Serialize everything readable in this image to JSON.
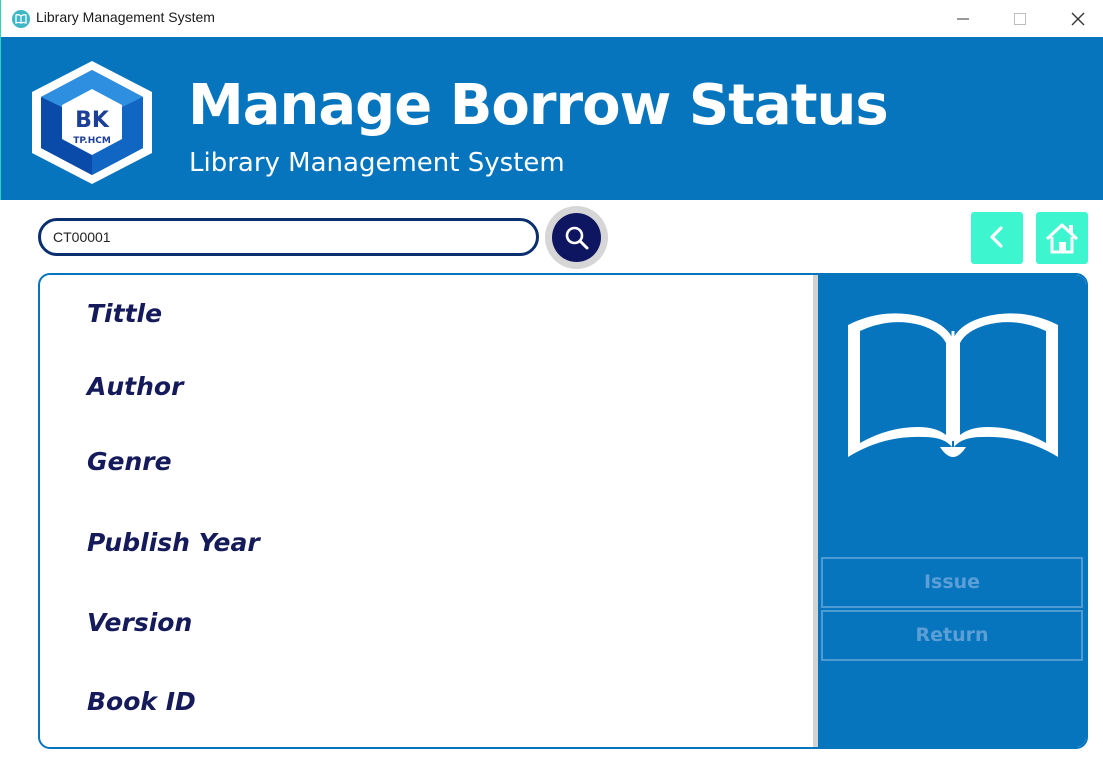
{
  "window": {
    "title": "Library Management System",
    "controls": [
      "minimize",
      "maximize",
      "close"
    ]
  },
  "header": {
    "logo": {
      "text": "BK",
      "subtext": "TP.HCM"
    },
    "title": "Manage Borrow Status",
    "subtitle": "Library Management System"
  },
  "search": {
    "value": "CT00001",
    "icon": "search-icon"
  },
  "nav": {
    "back_icon": "chevron-left-icon",
    "home_icon": "home-icon"
  },
  "fields": [
    {
      "label": "Tittle"
    },
    {
      "label": "Author"
    },
    {
      "label": "Genre"
    },
    {
      "label": "Publish Year"
    },
    {
      "label": "Version"
    },
    {
      "label": "Book ID"
    }
  ],
  "actions": {
    "issue_label": "Issue",
    "return_label": "Return"
  },
  "colors": {
    "primary": "#0675bd",
    "accent": "#3df5cf",
    "dark_navy": "#0f1661",
    "label_text": "#151a5a"
  }
}
